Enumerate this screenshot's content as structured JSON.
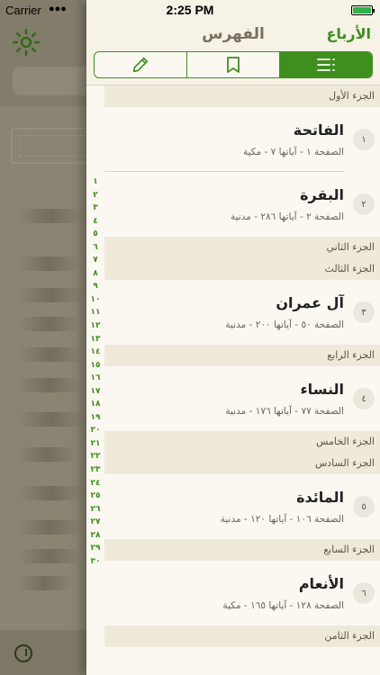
{
  "status": {
    "carrier": "Carrier",
    "time": "2:25 PM"
  },
  "header": {
    "title": "الفهرس",
    "quarters_label": "الأرباع"
  },
  "tabs": [
    {
      "name": "notes",
      "icon": "pencil-icon"
    },
    {
      "name": "bookmarks",
      "icon": "bookmark-icon"
    },
    {
      "name": "index",
      "icon": "list-icon",
      "active": true
    }
  ],
  "juz_numbers": [
    "١",
    "٢",
    "٣",
    "٤",
    "٥",
    "٦",
    "٧",
    "٨",
    "٩",
    "١٠",
    "١١",
    "١٢",
    "١٣",
    "١٤",
    "١٥",
    "١٦",
    "١٧",
    "١٨",
    "١٩",
    "٢٠",
    "٢١",
    "٢٢",
    "٢٣",
    "٢٤",
    "٢٥",
    "٢٦",
    "٢٧",
    "٢٨",
    "٢٩",
    "٣٠"
  ],
  "list": {
    "juz1": "الجزء الأول",
    "s1": {
      "name": "الفاتحة",
      "info": "الصفحة ١ - آياتها ٧ - مكية",
      "num": "١"
    },
    "s2": {
      "name": "البقرة",
      "info": "الصفحة ٢ - آياتها ٢٨٦ - مدنية",
      "num": "٢"
    },
    "juz2": "الجزء الثاني",
    "juz3": "الجزء الثالث",
    "s3": {
      "name": "آل عمران",
      "info": "الصفحة ٥٠ - آياتها ٢٠٠ - مدنية",
      "num": "٣"
    },
    "juz4": "الجزء الرابع",
    "s4": {
      "name": "النساء",
      "info": "الصفحة ٧٧ - آياتها ١٧٦ - مدنية",
      "num": "٤"
    },
    "juz5": "الجزء الخامس",
    "juz6": "الجزء السادس",
    "s5": {
      "name": "المائدة",
      "info": "الصفحة ١٠٦ - آياتها ١٢٠ - مدنية",
      "num": "٥"
    },
    "juz7": "الجزء السابع",
    "s6": {
      "name": "الأنعام",
      "info": "الصفحة ١٢٨ - آياتها ١٦٥ - مكية",
      "num": "٦"
    },
    "juz8": "الجزء الثامن"
  },
  "colors": {
    "accent": "#3f8f1f",
    "panel_bg": "#fbf8f1",
    "juz_bg": "#efe9da"
  }
}
